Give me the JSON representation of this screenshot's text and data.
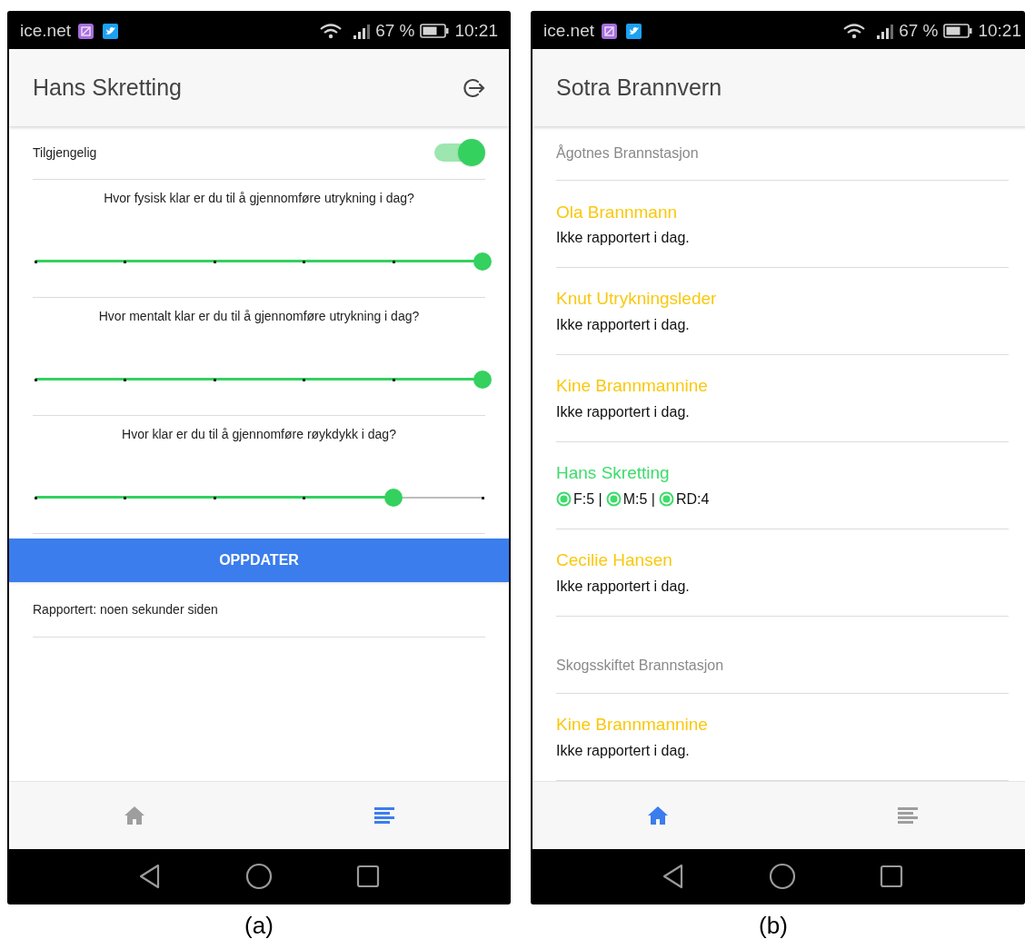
{
  "phones": [
    {
      "kind": "profile",
      "caption": "(a)",
      "status_bar": {
        "carrier": "ice.net",
        "battery": "67 %",
        "time": "10:21"
      },
      "title": "Hans Skretting",
      "availability": {
        "label": "Tilgjengelig",
        "on": true
      },
      "questions": [
        {
          "text": "Hvor fysisk klar er du til å gjennomføre utrykning i dag?",
          "level": 1
        },
        {
          "text": "Hvor mentalt klar er du til å gjennomføre utrykning i dag?",
          "level": 1
        },
        {
          "text": "Hvor klar er du til å gjennomføre røykdykk i dag?",
          "level": 0.8
        }
      ],
      "button": "OPPDATER",
      "reported": "Rapportert: noen sekunder siden",
      "nav": [
        {
          "kind": "home",
          "selected": false
        },
        {
          "kind": "list",
          "selected": true
        }
      ]
    },
    {
      "kind": "overview",
      "caption": "(b)",
      "status_bar": {
        "carrier": "ice.net",
        "battery": "67 %",
        "time": "10:21"
      },
      "title": "Sotra Brannvern",
      "sections": [
        {
          "title": "Ågotnes Brannstasjon",
          "members": [
            {
              "name": "Ola Brannmann",
              "reported": false,
              "status": "Ikke rapportert i dag."
            },
            {
              "name": "Knut Utrykningsleder",
              "reported": false,
              "status": "Ikke rapportert i dag."
            },
            {
              "name": "Kine Brannmannine",
              "reported": false,
              "status": "Ikke rapportert i dag."
            },
            {
              "name": "Hans Skretting",
              "reported": true,
              "scores": [
                "F:5 |",
                "M:5 |",
                "RD:4"
              ]
            },
            {
              "name": "Cecilie Hansen",
              "reported": false,
              "status": "Ikke rapportert i dag."
            }
          ]
        },
        {
          "title": "Skogsskiftet Brannstasjon",
          "members": [
            {
              "name": "Kine Brannmannine",
              "reported": false,
              "status": "Ikke rapportert i dag."
            }
          ]
        }
      ],
      "nav": [
        {
          "kind": "home",
          "selected": true
        },
        {
          "kind": "list",
          "selected": false
        }
      ]
    }
  ]
}
